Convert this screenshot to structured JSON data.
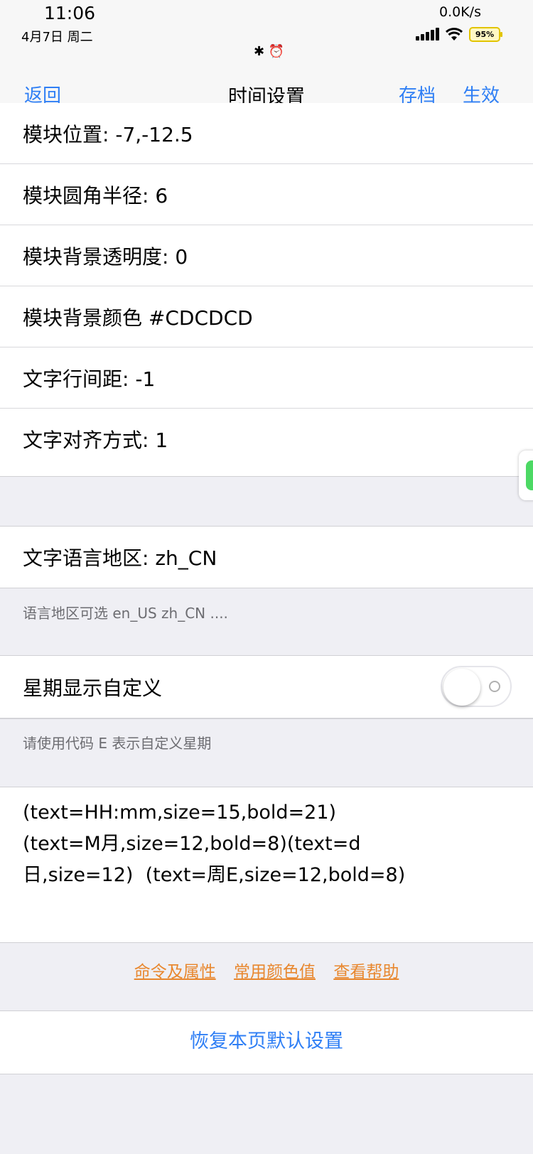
{
  "status_bar": {
    "time": "11:06",
    "date": "4月7日  周二",
    "net_speed": "0.0K/s",
    "center_icons": "✱ ⏰",
    "battery": "95%"
  },
  "nav": {
    "back": "返回",
    "title": "时间设置",
    "save": "存档",
    "apply": "生效"
  },
  "settings_top": [
    "模块位置: -7,-12.5",
    "模块圆角半径: 6",
    "模块背景透明度: 0",
    "模块背景颜色 #CDCDCD",
    "文字行间距: -1",
    "文字对齐方式: 1"
  ],
  "locale": {
    "label": "文字语言地区: zh_CN",
    "hint": "语言地区可选 en_US zh_CN ...."
  },
  "weekday": {
    "label": "星期显示自定义",
    "toggle_on": false,
    "hint": "请使用代码 E 表示自定义星期"
  },
  "format_code": "(text=HH:mm,size=15,bold=21)\n(text=M月,size=12,bold=8)(text=d\n日,size=12)  (text=周E,size=12,bold=8)",
  "links": [
    "命令及属性",
    "常用颜色值",
    "查看帮助"
  ],
  "restore_button": "恢复本页默认设置",
  "colors": {
    "accent_blue": "#2f7ff5",
    "link_orange": "#e8872e",
    "background": "#efeff4"
  }
}
